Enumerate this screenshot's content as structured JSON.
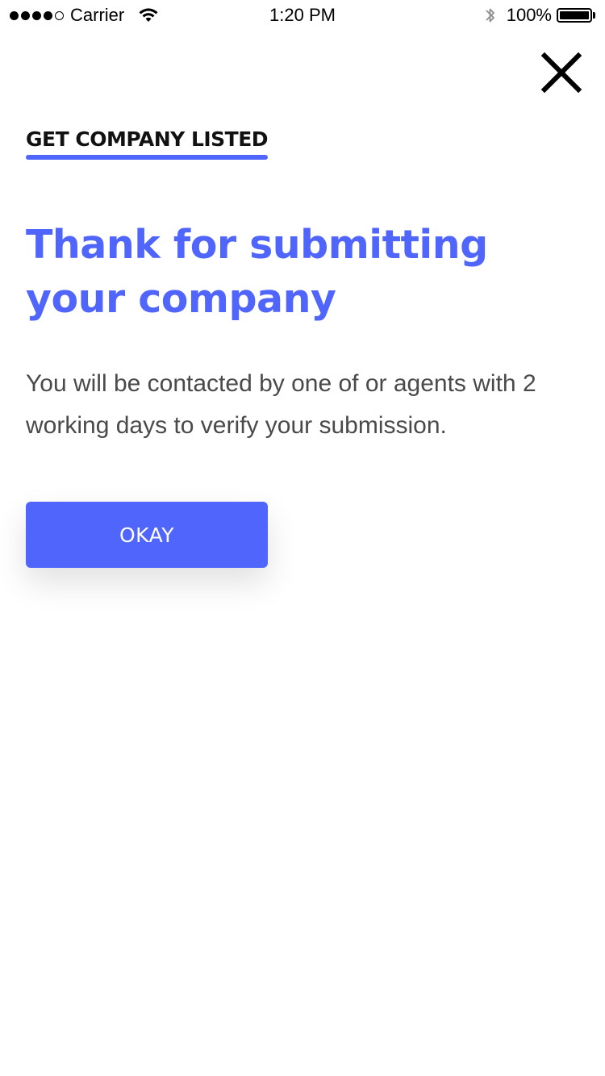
{
  "status_bar": {
    "carrier": "Carrier",
    "time": "1:20 PM",
    "battery_percent": "100%",
    "signal_bars_filled": 4,
    "signal_bars_total": 5,
    "battery_level": 1.0
  },
  "header": {
    "close_icon": "close-icon",
    "section_label": "GET COMPANY LISTED"
  },
  "main": {
    "headline": "Thank for submitting your company",
    "message": "You will be contacted by one of or agents with 2 working days to verify your submission.",
    "okay_label": "OKAY"
  },
  "colors": {
    "accent": "#5065fb",
    "body_text": "#4a4a4a",
    "heading_text": "#111111"
  }
}
